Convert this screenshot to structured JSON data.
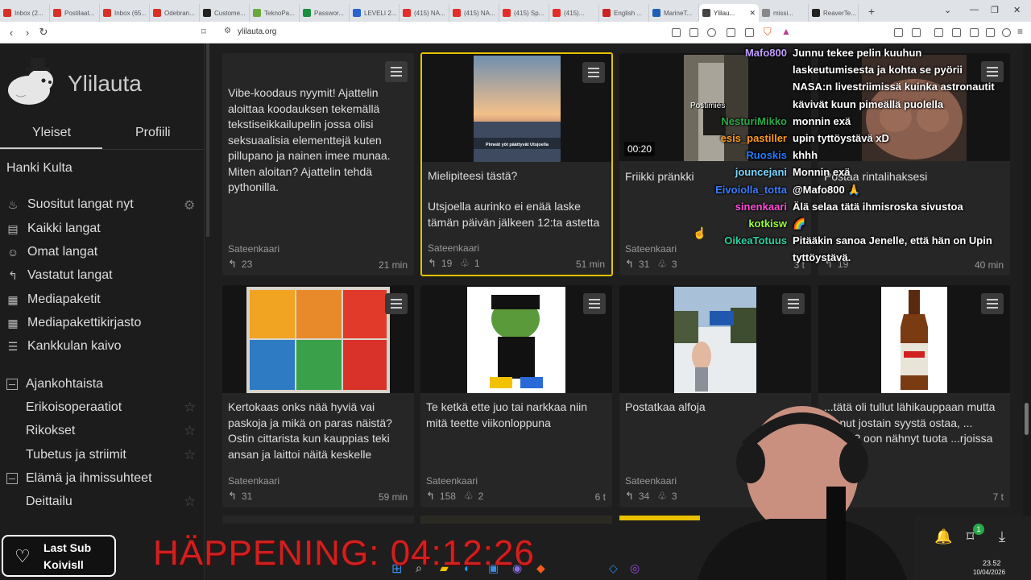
{
  "browser": {
    "tabs": [
      {
        "label": "Inbox (2...",
        "color": "#d93025"
      },
      {
        "label": "Postilaat...",
        "color": "#d93025"
      },
      {
        "label": "Inbox (65...",
        "color": "#d93025"
      },
      {
        "label": "Odebran...",
        "color": "#d93025"
      },
      {
        "label": "Custome...",
        "color": "#222222"
      },
      {
        "label": "TeknoPa...",
        "color": "#6aaa3a"
      },
      {
        "label": "Passwor...",
        "color": "#1a8f3c"
      },
      {
        "label": "LEVELI 2...",
        "color": "#2a62d4"
      },
      {
        "label": "(415) NA...",
        "color": "#e52d27"
      },
      {
        "label": "(415) NA...",
        "color": "#e52d27"
      },
      {
        "label": "(415) Sp...",
        "color": "#e52d27"
      },
      {
        "label": "(415)...",
        "color": "#e52d27"
      },
      {
        "label": "English ...",
        "color": "#cc2222"
      },
      {
        "label": "MarineT...",
        "color": "#1d5fb8"
      },
      {
        "label": "Ylilau...",
        "color": "#444444",
        "active": true
      },
      {
        "label": "missi...",
        "color": "#888888"
      },
      {
        "label": "ReaverTe...",
        "color": "#222222"
      }
    ],
    "url": "ylilauta.org"
  },
  "sidebar": {
    "site_name": "Ylilauta",
    "tabs": [
      "Yleiset",
      "Profiili"
    ],
    "hanki": "Hanki Kulta",
    "nav": [
      {
        "label": "Suositut langat nyt",
        "icon": "fire-icon"
      },
      {
        "label": "Kaikki langat",
        "icon": "list-icon"
      },
      {
        "label": "Omat langat",
        "icon": "user-threads-icon"
      },
      {
        "label": "Vastatut langat",
        "icon": "reply-icon"
      },
      {
        "label": "Mediapaketit",
        "icon": "media-pack-icon"
      },
      {
        "label": "Mediapakettikirjasto",
        "icon": "library-icon"
      },
      {
        "label": "Kankkulan kaivo",
        "icon": "well-icon"
      }
    ],
    "categories": [
      {
        "label": "Ajankohtaista",
        "items": [
          "Erikoisoperaatiot",
          "Rikokset",
          "Tubetus ja striimit"
        ]
      },
      {
        "label": "Elämä ja ihmissuhteet",
        "items": [
          "Deittailu"
        ]
      }
    ]
  },
  "cards": [
    {
      "title": "Vibe-koodaus nyymit! Ajattelin aloittaa koodauksen tekemällä tekstiseikkailupelin jossa olisi seksuaalisia elementtejä kuten pillupano ja nainen imee munaa. Miten aloitan? Ajattelin tehdä pythonilla.",
      "body": "",
      "author": "Sateenkaari",
      "replies": "23",
      "reactions": "",
      "time": "21 min"
    },
    {
      "title": "Mielipiteesi tästä?",
      "body": "Utsjoella aurinko ei enää laske tämän päivän jälkeen 12:ta astetta",
      "author": "Sateenkaari",
      "replies": "19",
      "reactions": "1",
      "time": "51 min",
      "img_caption": "Pimeät yöt päättyvät Utsjoella"
    },
    {
      "title": "Friikki pränkki",
      "body": "",
      "author": "Sateenkaari",
      "replies": "31",
      "reactions": "3",
      "time": "3 t",
      "duration": "00:20",
      "img_caption": "Postimies"
    },
    {
      "title": "Postaa rintalihaksesi",
      "body": "",
      "author": "Sateenkaari",
      "replies": "19",
      "reactions": "",
      "time": "40 min"
    },
    {
      "title": "Kertokaas onks nää hyviä vai paskoja ja mikä on paras näistä? Ostin cittarista kun kauppias teki ansan ja laittoi näitä keskelle",
      "body": "",
      "author": "Sateenkaari",
      "replies": "31",
      "reactions": "",
      "time": "59 min"
    },
    {
      "title": "Te ketkä ette juo tai narkkaa niin mitä teette viikonloppuna",
      "body": "",
      "author": "Sateenkaari",
      "replies": "158",
      "reactions": "2",
      "time": "6 t"
    },
    {
      "title": "Postatkaa alfoja",
      "body": "",
      "author": "Sateenkaari",
      "replies": "34",
      "reactions": "3",
      "time": ""
    },
    {
      "title": "...tätä oli tullut lähikauppaan mutta ...anut jostain syystä ostaa, ... hyvää? oon nähnyt tuota ...rjoissa",
      "body": "",
      "author": "",
      "replies": "",
      "reactions": "",
      "time": "7 t"
    }
  ],
  "chat": [
    {
      "user": "Mafo800",
      "color": "#c09cff",
      "text": "Junnu tekee pelin kuuhun"
    },
    {
      "user": "",
      "color": "#ffffff",
      "text": "laskeutumisesta ja kohta se pyörii"
    },
    {
      "user": "",
      "color": "#ffffff",
      "text": "NASA:n livestriimissä kuinka astronautit"
    },
    {
      "user": "",
      "color": "#ffffff",
      "text": "kävivät kuun pimeällä puolella"
    },
    {
      "user": "NesturiMikko",
      "color": "#2aa84a",
      "text": "monnin exä"
    },
    {
      "user": "esis_pastiller",
      "color": "#ff9a1f",
      "text": "upin tyttöystävä xD"
    },
    {
      "user": "Ruoskis",
      "color": "#1e7bff",
      "text": "khhh"
    },
    {
      "user": "jouncejani",
      "color": "#7ad7ff",
      "text": "Monnin exä"
    },
    {
      "user": "Eivoiolla_totta",
      "color": "#3a7cff",
      "text": "@Mafo800 🙏"
    },
    {
      "user": "sinenkaari",
      "color": "#ff4fd8",
      "text": "Älä selaa tätä ihmisroska sivustoa"
    },
    {
      "user": "kotkisw",
      "color": "#9aff3a",
      "text": "🌈"
    },
    {
      "user": "OikeaTotuus",
      "color": "#30d0a0",
      "text": "Pitääkin sanoa Jenelle, että hän on Upin"
    },
    {
      "user": "",
      "color": "#ffffff",
      "text": "tyttöystävä."
    }
  ],
  "overlay": {
    "sub_line1": "Last Sub",
    "sub_line2": "Koivisll",
    "happening": "HÄPPENING: 04:12:26",
    "clock_time": "23.52",
    "clock_date": "10/04/2026",
    "notif_count": "1"
  }
}
